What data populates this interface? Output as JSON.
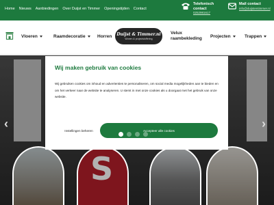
{
  "topbar": {
    "links": [
      "Home",
      "Nieuws",
      "Aanbiedingen",
      "Over Duijst en Timmer",
      "Openingstijden",
      "Contact"
    ],
    "phone": {
      "title_line1": "Telefonisch",
      "title_line2": "contact",
      "value": "0252981617"
    },
    "mail": {
      "title": "Mail contact",
      "value": "info@duijstentimmer.nl"
    }
  },
  "nav": {
    "vloeren": "Vloeren",
    "raamdecoratie": "Raamdecoratie",
    "horren": "Horren",
    "velux_line1": "Velux",
    "velux_line2": "raambekleding",
    "projecten": "Projecten",
    "trappen": "Trappen"
  },
  "logo": {
    "name": "Duijst & Timmer.nl",
    "tagline": "Wonen & projectstoffering"
  },
  "cookie": {
    "title": "Wij maken gebruik van cookies",
    "text": "Wij gebruiken cookies om inhoud en advertenties te personaliseren, om social media mogelijkheden aan te bieden en om het verkeer naar de website te analyseren. U stemt in met onze cookies als u doorgaat met het gebruik van onze website.",
    "settings_label": "Instellingen beheren",
    "accept_label": "Accepteer alle cookies"
  },
  "slider": {
    "prev": "‹",
    "next": "›",
    "dot_count": 4,
    "active_index": 0
  },
  "colors": {
    "brand_green": "#1d7a3e"
  },
  "icons": [
    "home-icon",
    "phone-icon",
    "mail-icon",
    "chevron-left-icon",
    "chevron-right-icon"
  ]
}
